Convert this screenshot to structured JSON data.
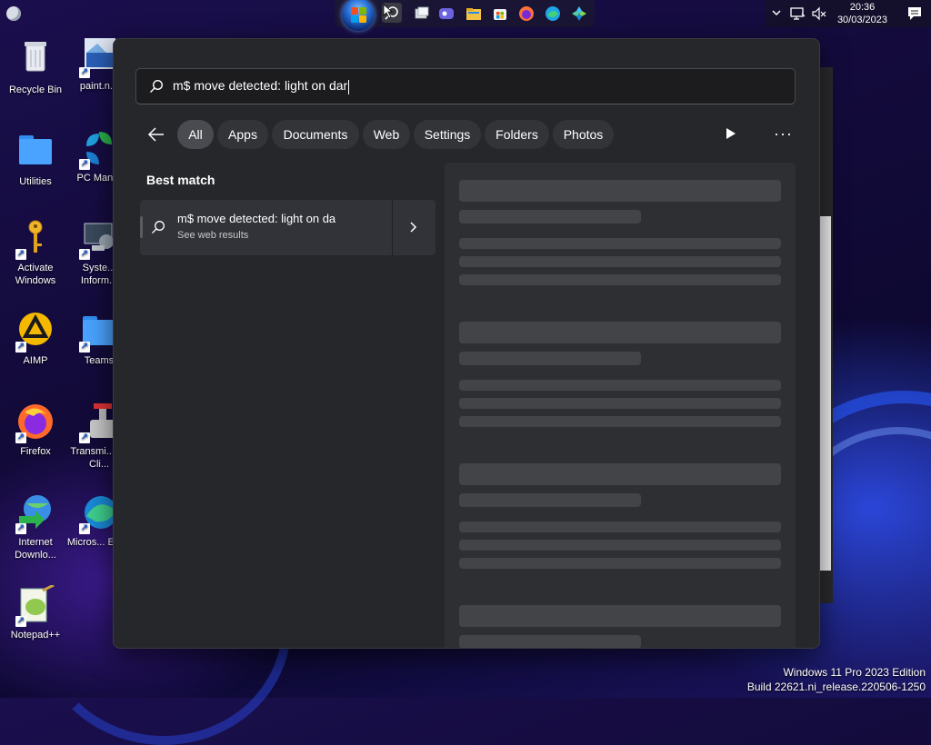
{
  "taskbar": {
    "time": "20:36",
    "date": "30/03/2023",
    "icons": [
      "start-button",
      "cursor-app",
      "search",
      "task-view",
      "chat",
      "file-explorer",
      "store",
      "firefox",
      "edge",
      "photos"
    ]
  },
  "desktop": {
    "icons": [
      {
        "label": "Recycle Bin"
      },
      {
        "label": "paint.n..."
      },
      {
        "label": "Utilities"
      },
      {
        "label": "PC Man..."
      },
      {
        "label": "Activate Windows"
      },
      {
        "label": "Syste... Inform..."
      },
      {
        "label": "AIMP"
      },
      {
        "label": "Teams"
      },
      {
        "label": "Firefox"
      },
      {
        "label": "Transmi... Qt Cli..."
      },
      {
        "label": "Internet Downlo..."
      },
      {
        "label": "Micros... Edge"
      },
      {
        "label": "Notepad++"
      }
    ]
  },
  "search": {
    "query": "m$ move detected: light on dar",
    "filters": [
      "All",
      "Apps",
      "Documents",
      "Web",
      "Settings",
      "Folders",
      "Photos"
    ],
    "active_filter": "All",
    "best_match_title": "Best match",
    "result": {
      "title": "m$ move detected: light on da",
      "subtitle": "See web results"
    }
  },
  "watermark": {
    "line1": "Windows 11 Pro 2023 Edition",
    "line2": "Build 22621.ni_release.220506-1250"
  }
}
